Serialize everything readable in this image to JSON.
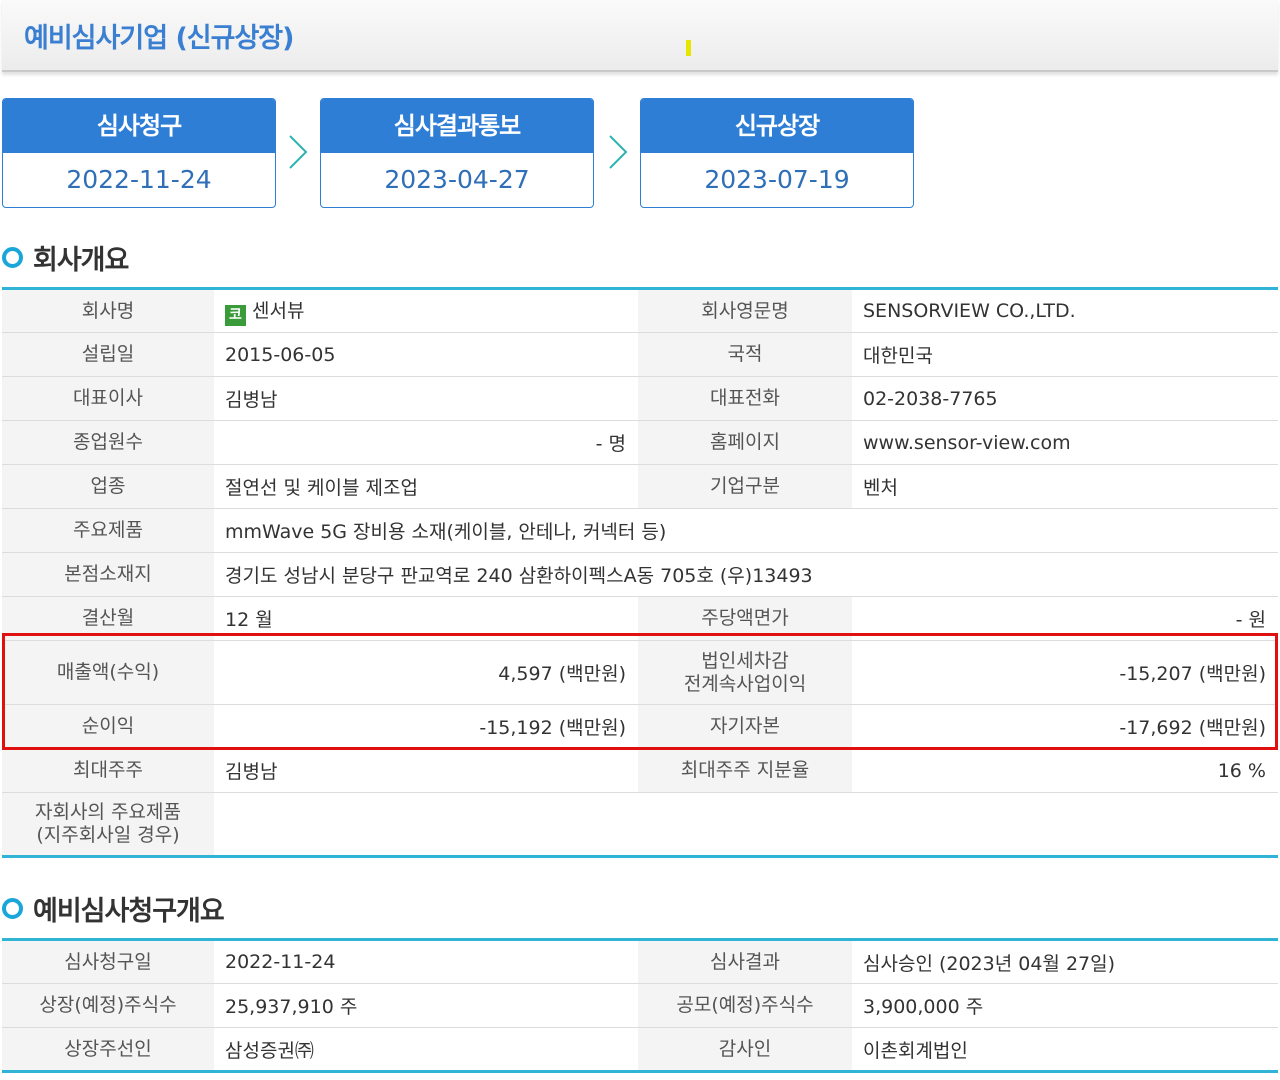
{
  "page": {
    "title": "예비심사기업 (신규상장)"
  },
  "steps": [
    {
      "label": "심사청구",
      "date": "2022-11-24"
    },
    {
      "label": "심사결과통보",
      "date": "2023-04-27"
    },
    {
      "label": "신규상장",
      "date": "2023-07-19"
    }
  ],
  "company": {
    "section_title": "회사개요",
    "market_badge": "코",
    "rows": [
      {
        "l1": "회사명",
        "v1": "센서뷰",
        "l2": "회사영문명",
        "v2": "SENSORVIEW CO.,LTD."
      },
      {
        "l1": "설립일",
        "v1": "2015-06-05",
        "l2": "국적",
        "v2": "대한민국"
      },
      {
        "l1": "대표이사",
        "v1": "김병남",
        "l2": "대표전화",
        "v2": "02-2038-7765"
      },
      {
        "l1": "종업원수",
        "v1": "- 명",
        "l2": "홈페이지",
        "v2": "www.sensor-view.com"
      },
      {
        "l1": "업종",
        "v1": "절연선 및 케이블 제조업",
        "l2": "기업구분",
        "v2": "벤처"
      },
      {
        "l1": "주요제품",
        "v1": "mmWave 5G 장비용 소재(케이블, 안테나, 커넥터 등)"
      },
      {
        "l1": "본점소재지",
        "v1": "경기도 성남시 분당구 판교역로 240 삼환하이펙스A동 705호 (우)13493"
      },
      {
        "l1": "결산월",
        "v1": "12 월",
        "l2": "주당액면가",
        "v2": "- 원"
      },
      {
        "l1": "매출액(수익)",
        "v1": "4,597 (백만원)",
        "l2a": "법인세차감",
        "l2b": "전계속사업이익",
        "v2": "-15,207 (백만원)"
      },
      {
        "l1": "순이익",
        "v1": "-15,192 (백만원)",
        "l2": "자기자본",
        "v2": "-17,692 (백만원)"
      },
      {
        "l1": "최대주주",
        "v1": "김병남",
        "l2": "최대주주 지분율",
        "v2": "16 %"
      },
      {
        "l1a": "자회사의 주요제품",
        "l1b": "(지주회사일 경우)",
        "v1": ""
      }
    ]
  },
  "review": {
    "section_title": "예비심사청구개요",
    "rows": [
      {
        "l1": "심사청구일",
        "v1": "2022-11-24",
        "l2": "심사결과",
        "v2": "심사승인 (2023년 04월 27일)"
      },
      {
        "l1": "상장(예정)주식수",
        "v1": "25,937,910 주",
        "l2": "공모(예정)주식수",
        "v2": "3,900,000 주"
      },
      {
        "l1": "상장주선인",
        "v1": "삼성증권㈜",
        "l2": "감사인",
        "v2": "이촌회계법인"
      }
    ]
  },
  "colors": {
    "accent_blue": "#2f7ed6",
    "section_line": "#2fb4d6",
    "highlight_red": "#e01010"
  }
}
